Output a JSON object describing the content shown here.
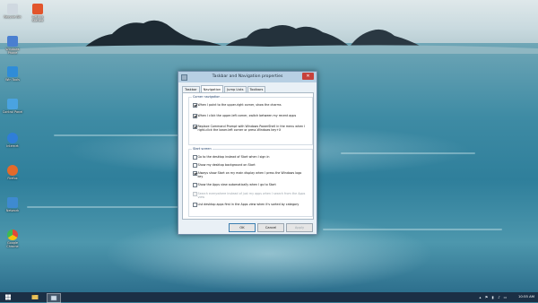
{
  "desktop": {
    "icons": [
      {
        "label": "Recycle Bin",
        "icon": "recycle-bin-icon",
        "color": "#cfd8e0"
      },
      {
        "label": "Getting Started",
        "icon": "office-icon",
        "color": "#e2552c"
      },
      {
        "label": "Windows Phone",
        "icon": "app-icon",
        "color": "#4a7fd0"
      },
      {
        "label": "Win Tools",
        "icon": "app-icon",
        "color": "#2f8cd8"
      },
      {
        "label": "Control Panel",
        "icon": "control-panel-icon",
        "color": "#4aa3e0"
      },
      {
        "label": "Internet",
        "icon": "ie-icon",
        "color": "#2f7ed8"
      },
      {
        "label": "Firefox",
        "icon": "firefox-icon",
        "color": "#e46a2a"
      },
      {
        "label": "Network",
        "icon": "network-icon",
        "color": "#3e8ad0"
      },
      {
        "label": "Google Chrome",
        "icon": "chrome-icon",
        "color": "#e0483a"
      }
    ]
  },
  "dialog": {
    "title": "Taskbar and Navigation properties",
    "close_glyph": "✕",
    "tabs": [
      "Taskbar",
      "Navigation",
      "Jump Lists",
      "Toolbars"
    ],
    "active_tab": 1,
    "corner_group": {
      "title": "Corner navigation",
      "options": [
        {
          "text": "When I point to the upper-right corner, show the charms",
          "checked": true,
          "enabled": true
        },
        {
          "text": "When I click the upper-left corner, switch between my recent apps",
          "checked": true,
          "enabled": true
        },
        {
          "text": "Replace Command Prompt with Windows PowerShell in the menu when I right-click the lower-left corner or press Windows key+X",
          "checked": true,
          "enabled": true
        }
      ]
    },
    "start_group": {
      "title": "Start screen",
      "options": [
        {
          "text": "Go to the desktop instead of Start when I sign in",
          "checked": false,
          "enabled": true
        },
        {
          "text": "Show my desktop background on Start",
          "checked": false,
          "enabled": true
        },
        {
          "text": "Always show Start on my main display when I press the Windows logo key",
          "checked": true,
          "enabled": true
        },
        {
          "text": "Show the Apps view automatically when I go to Start",
          "checked": false,
          "enabled": true
        },
        {
          "text": "Search everywhere instead of just my apps when I search from the Apps view",
          "checked": false,
          "enabled": false
        },
        {
          "text": "List desktop apps first in the Apps view when it's sorted by category",
          "checked": false,
          "enabled": true
        }
      ]
    },
    "buttons": {
      "ok": "OK",
      "cancel": "Cancel",
      "apply": "Apply"
    }
  },
  "taskbar": {
    "clock": "10:55 AM",
    "accent": "#1b2f45"
  }
}
